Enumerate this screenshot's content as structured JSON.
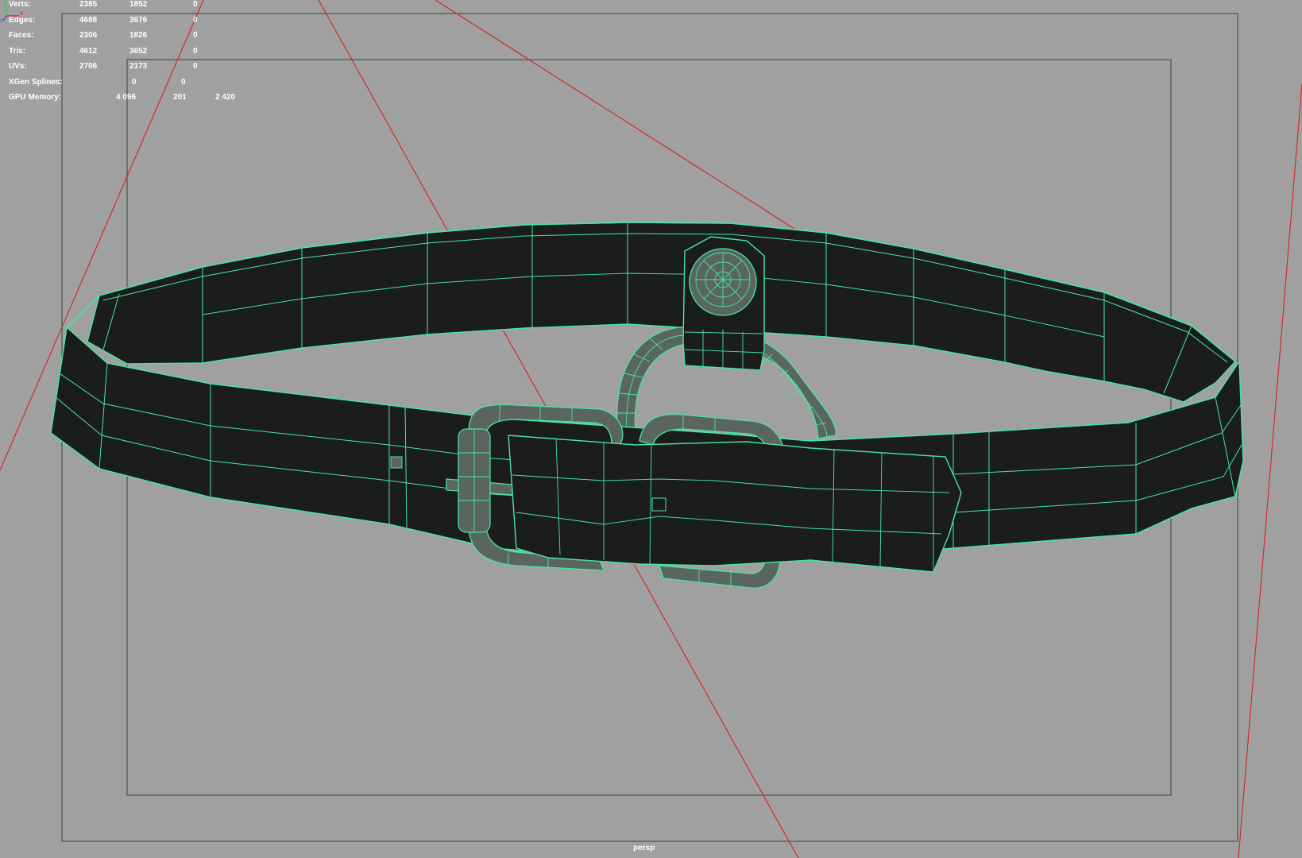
{
  "viewport": {
    "camera_label": "persp",
    "background_color": "#a0a0a0",
    "wireframe_color": "#46e6a0",
    "mesh_color": "#1b1d1c",
    "metal_color": "#5a6560",
    "frame_color": "#3c5a46",
    "guide_line_color": "#d62222"
  },
  "hud_stats": [
    {
      "label": "Verts:",
      "v1": "2385",
      "v2": "1852",
      "v3": "0",
      "v4": ""
    },
    {
      "label": "Edges:",
      "v1": "4688",
      "v2": "3676",
      "v3": "0",
      "v4": ""
    },
    {
      "label": "Faces:",
      "v1": "2306",
      "v2": "1826",
      "v3": "0",
      "v4": ""
    },
    {
      "label": "Tris:",
      "v1": "4612",
      "v2": "3652",
      "v3": "0",
      "v4": ""
    },
    {
      "label": "UVs:",
      "v1": "2706",
      "v2": "2173",
      "v3": "0",
      "v4": ""
    },
    {
      "label": "XGen Splines:",
      "v1": "",
      "v2": "0",
      "v3": "0",
      "v4": ""
    },
    {
      "label": "GPU Memory:",
      "v1": "",
      "v2": "4 096",
      "v3": "201",
      "v4": "2 420"
    }
  ],
  "axis_gizmo": {
    "x_label": "x",
    "y_label": "y",
    "z_label": "z"
  }
}
